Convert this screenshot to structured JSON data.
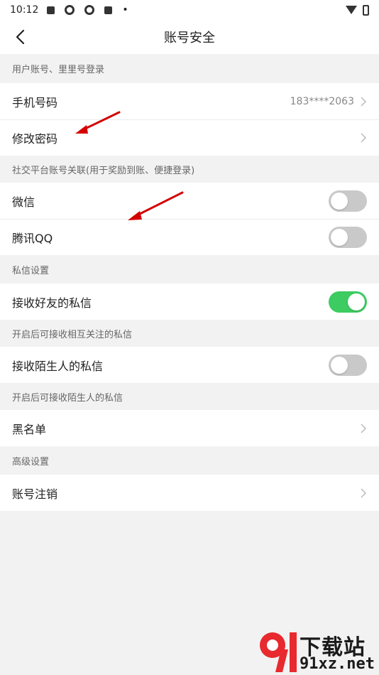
{
  "status": {
    "time": "10:12",
    "dot": "•"
  },
  "header": {
    "title": "账号安全"
  },
  "sections": {
    "login": {
      "header": "用户账号、里里号登录"
    },
    "social": {
      "header": "社交平台账号关联(用于奖励到账、便捷登录)"
    },
    "message": {
      "header": "私信设置"
    },
    "friend_note": {
      "header": "开启后可接收相互关注的私信"
    },
    "stranger_note": {
      "header": "开启后可接收陌生人的私信"
    },
    "advanced": {
      "header": "高级设置"
    }
  },
  "rows": {
    "phone": {
      "label": "手机号码",
      "value": "183****2063"
    },
    "password": {
      "label": "修改密码"
    },
    "wechat": {
      "label": "微信",
      "enabled": false
    },
    "qq": {
      "label": "腾讯QQ",
      "enabled": false
    },
    "friend_msg": {
      "label": "接收好友的私信",
      "enabled": true
    },
    "stranger_msg": {
      "label": "接收陌生人的私信",
      "enabled": false
    },
    "blacklist": {
      "label": "黑名单"
    },
    "cancel": {
      "label": "账号注销"
    }
  },
  "watermark": {
    "line1": "下载站",
    "line2": "91xz.net"
  },
  "colors": {
    "toggle_on": "#3ccc61",
    "toggle_off": "#c9c9c9",
    "annotation_arrow": "#d40000",
    "watermark_red": "#e8292e"
  }
}
